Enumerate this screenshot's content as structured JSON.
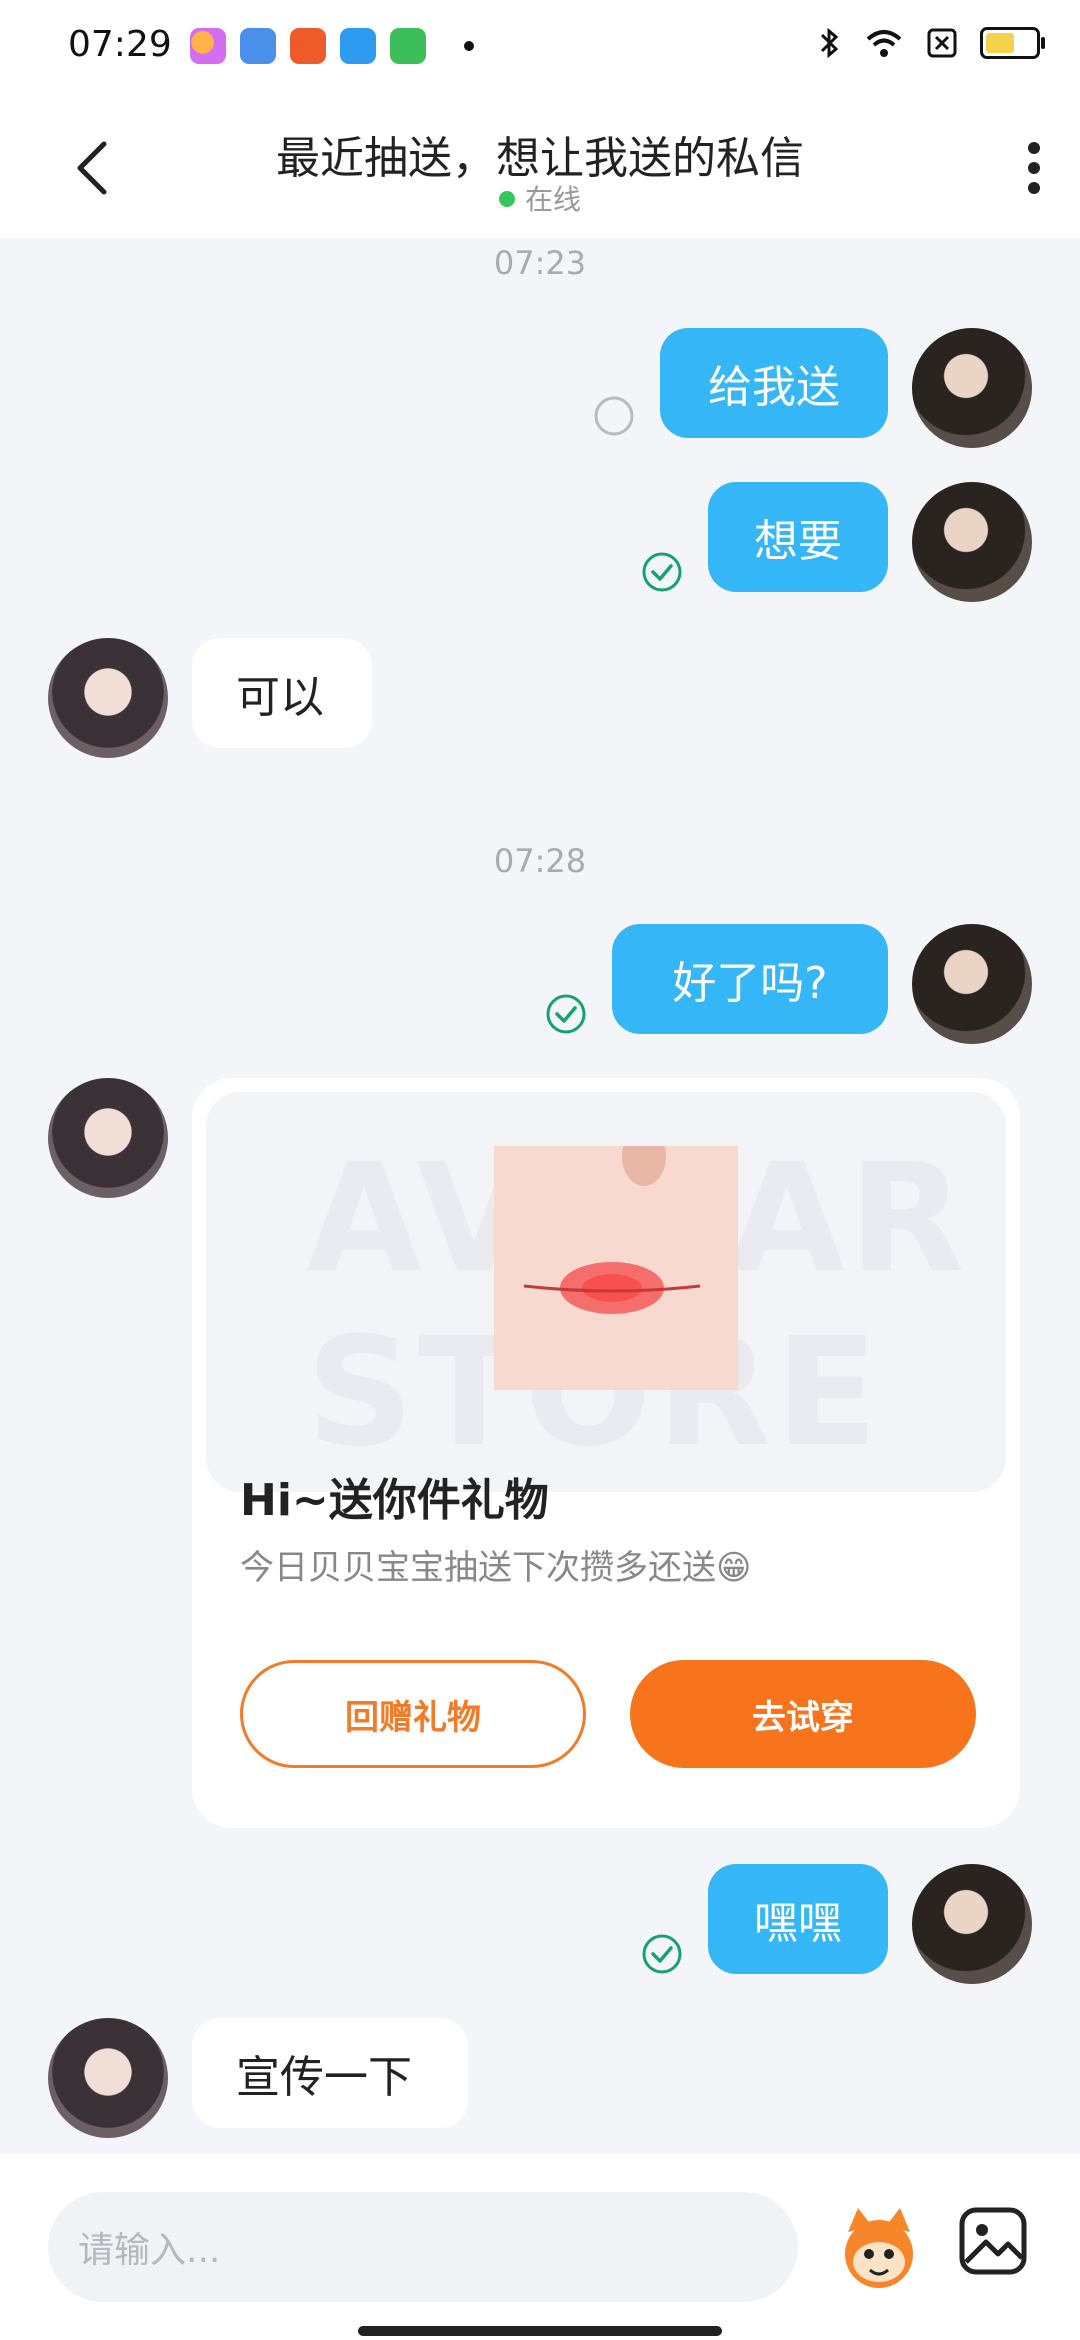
{
  "status_bar": {
    "time": "07:29"
  },
  "header": {
    "title": "最近抽送，想让我送的私信",
    "online_status": "在线"
  },
  "chat": {
    "timestamps": [
      "07:23",
      "07:28"
    ],
    "messages": [
      {
        "sender": "me",
        "text": "给我送",
        "status": "sending"
      },
      {
        "sender": "me",
        "text": "想要",
        "status": "read"
      },
      {
        "sender": "other",
        "text": "可以"
      },
      {
        "sender": "me",
        "text": "好了吗?",
        "status": "read"
      },
      {
        "sender": "me",
        "text": "嘿嘿",
        "status": "read"
      },
      {
        "sender": "other",
        "text": "宣传一下"
      }
    ],
    "gift_card": {
      "watermark": "AVATAR STORE",
      "title": "Hi~送你件礼物",
      "description": "今日贝贝宝宝抽送下次攒多还送😁",
      "return_gift_label": "回赠礼物",
      "try_on_label": "去试穿"
    }
  },
  "input_bar": {
    "placeholder": "请输入..."
  },
  "colors": {
    "my_bubble": "#35b6f6",
    "accent_orange": "#f7741c",
    "online_green": "#35c759",
    "read_check": "#16a36b"
  }
}
